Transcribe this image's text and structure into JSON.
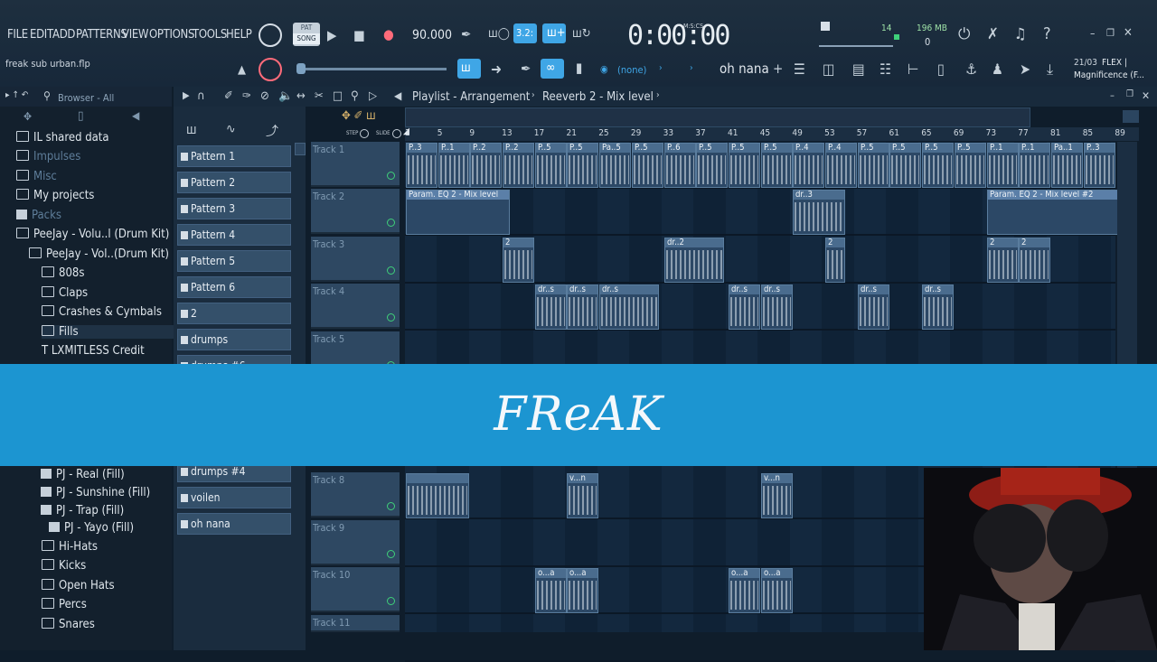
{
  "menu": [
    "FILE",
    "EDIT",
    "ADD",
    "PATTERNS",
    "VIEW",
    "OPTIONS",
    "TOOLS",
    "HELP"
  ],
  "project_file": "freak sub urban.flp",
  "transport": {
    "pat_label": "PAT",
    "song_label": "SONG",
    "tempo": "90.000",
    "time": "0:00:00",
    "time_format": "M:S:CS",
    "step_label": "STEP",
    "slide_label": "SLIDE",
    "snap_text": "3.2:",
    "cpu_value": "14",
    "memory": "196 MB",
    "memory_sub": "0",
    "none_label": "(none)",
    "hint_text": "oh nana",
    "plugin_date": "21/03",
    "plugin_name": "FLEX |",
    "plugin_preset": "Magnificence (F..."
  },
  "browser": {
    "title": "Browser - All",
    "items": [
      {
        "label": "IL shared data",
        "indent": 0,
        "dim": false
      },
      {
        "label": "Impulses",
        "indent": 0,
        "dim": true
      },
      {
        "label": "Misc",
        "indent": 0,
        "dim": true
      },
      {
        "label": "My projects",
        "indent": 0,
        "dim": false
      },
      {
        "label": "Packs",
        "indent": 0,
        "dim": true
      },
      {
        "label": "PeeJay - Volu..l (Drum Kit)",
        "indent": 0,
        "dim": false
      },
      {
        "label": "PeeJay - Vol..(Drum Kit)",
        "indent": 1,
        "dim": false
      },
      {
        "label": "808s",
        "indent": 2,
        "dim": false
      },
      {
        "label": "Claps",
        "indent": 2,
        "dim": false
      },
      {
        "label": "Crashes & Cymbals",
        "indent": 2,
        "dim": false
      },
      {
        "label": "Fills",
        "indent": 2,
        "dim": false
      },
      {
        "label": "LXMITLESS Credit",
        "indent": 2,
        "dim": false
      }
    ],
    "lower_items": [
      {
        "label": "PJ - Real (Fill)",
        "indent": 3
      },
      {
        "label": "PJ - Sunshine (Fill)",
        "indent": 3
      },
      {
        "label": "PJ - Trap (Fill)",
        "indent": 3
      },
      {
        "label": "PJ - Yayo (Fill)",
        "indent": 4
      },
      {
        "label": "Hi-Hats",
        "indent": 2
      },
      {
        "label": "Kicks",
        "indent": 2
      },
      {
        "label": "Open Hats",
        "indent": 2
      },
      {
        "label": "Percs",
        "indent": 2
      },
      {
        "label": "Snares",
        "indent": 2
      }
    ]
  },
  "playlist": {
    "breadcrumb_1": "Playlist - Arrangement",
    "breadcrumb_2": "Reeverb 2 - Mix level",
    "ruler": [
      "1",
      "5",
      "9",
      "13",
      "17",
      "21",
      "25",
      "29",
      "33",
      "37",
      "41",
      "45",
      "49",
      "53",
      "57",
      "61",
      "65",
      "69",
      "73",
      "77",
      "81",
      "85",
      "89"
    ]
  },
  "patterns": [
    "Pattern 1",
    "Pattern 2",
    "Pattern 3",
    "Pattern 4",
    "Pattern 5",
    "Pattern 6",
    "2",
    "drumps",
    "drumps #6",
    "drumps #4",
    "voilen",
    "oh nana"
  ],
  "tracks": [
    "Track 1",
    "Track 2",
    "Track 3",
    "Track 4",
    "Track 5",
    "Track 8",
    "Track 9",
    "Track 10",
    "Track 11"
  ],
  "clip_labels": {
    "t1": [
      "P..3",
      "P..1",
      "P..2",
      "P..2",
      "P..5",
      "P..5",
      "Pa..5",
      "P..5",
      "P..6",
      "P..5",
      "P..5",
      "P..5",
      "P..4",
      "P..4",
      "P..5",
      "P..5",
      "P..5",
      "P..5",
      "P..1",
      "P..1",
      "Pa..1",
      "P..3"
    ],
    "t2_auto_a": "Param. EQ 2 - Mix level",
    "t2_mid": "dr..3",
    "t2_auto_b": "Param. EQ 2 - Mix level #2",
    "t3": [
      "2",
      "dr..2",
      "2",
      "2",
      "2"
    ],
    "t4": [
      "dr..s",
      "dr..s",
      "dr..s",
      "dr..s",
      "dr..s",
      "dr..s",
      "dr..s"
    ],
    "t8": [
      "v...n",
      "v...n"
    ],
    "t10": [
      "o...a",
      "o...a",
      "o...a",
      "o...a"
    ]
  },
  "banner_text": "FReAK",
  "colors": {
    "banner": "#1c95d1",
    "accent_blue": "#3fa6e6",
    "panel": "#13202d"
  }
}
